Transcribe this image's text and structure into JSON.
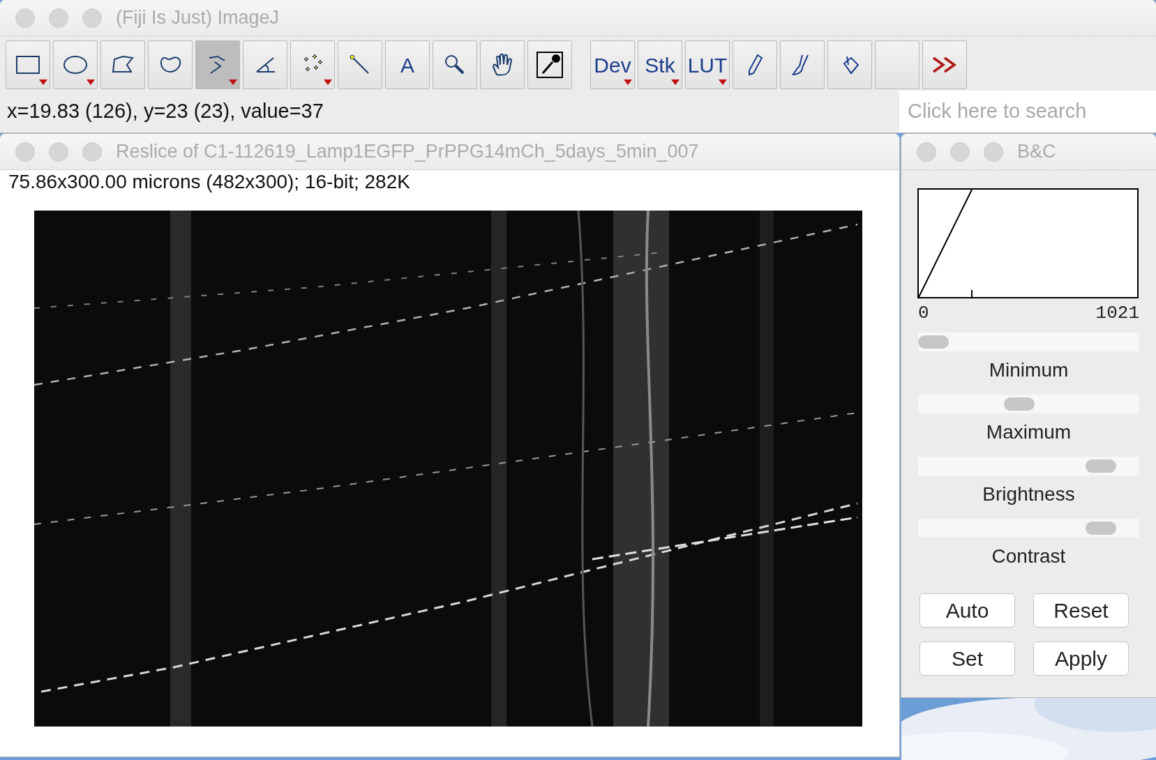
{
  "main_window": {
    "title": "(Fiji Is Just) ImageJ",
    "tools": [
      {
        "kind": "icon",
        "selected": false,
        "menu": true
      },
      {
        "kind": "icon",
        "selected": false,
        "menu": true
      },
      {
        "kind": "icon",
        "selected": false,
        "menu": false
      },
      {
        "kind": "icon",
        "selected": false,
        "menu": false
      },
      {
        "kind": "icon",
        "selected": true,
        "menu": true
      },
      {
        "kind": "icon",
        "selected": false,
        "menu": false
      },
      {
        "kind": "icon",
        "selected": false,
        "menu": true
      },
      {
        "kind": "icon",
        "selected": false,
        "menu": false
      },
      {
        "kind": "text",
        "label": "A",
        "selected": false,
        "menu": false
      },
      {
        "kind": "icon",
        "selected": false,
        "menu": false
      },
      {
        "kind": "icon",
        "selected": false,
        "menu": false
      },
      {
        "kind": "icon",
        "selected": false,
        "menu": false
      },
      {
        "kind": "text",
        "label": "Dev",
        "selected": false,
        "menu": true,
        "gap": true
      },
      {
        "kind": "text",
        "label": "Stk",
        "selected": false,
        "menu": true
      },
      {
        "kind": "text",
        "label": "LUT",
        "selected": false,
        "menu": true
      },
      {
        "kind": "icon",
        "selected": false,
        "menu": false
      },
      {
        "kind": "icon",
        "selected": false,
        "menu": false
      },
      {
        "kind": "icon",
        "selected": false,
        "menu": false
      },
      {
        "kind": "blank",
        "selected": false,
        "menu": false
      },
      {
        "kind": "more",
        "selected": false,
        "menu": false
      }
    ],
    "status": "x=19.83 (126), y=23 (23), value=37",
    "search": {
      "placeholder": "Click here to search"
    }
  },
  "image_window": {
    "title": "Reslice of C1-112619_Lamp1EGFP_PrPPG14mCh_5days_5min_007",
    "info": "75.86x300.00 microns (482x300); 16-bit; 282K"
  },
  "bc_window": {
    "title": "B&C",
    "histogram": {
      "min_label": "0",
      "max_label": "1021"
    },
    "sliders": [
      {
        "label": "Minimum",
        "level": 0.0
      },
      {
        "label": "Maximum",
        "level": 0.45
      },
      {
        "label": "Brightness",
        "level": 0.88
      },
      {
        "label": "Contrast",
        "level": 0.88
      }
    ],
    "buttons": [
      "Auto",
      "Reset",
      "Set",
      "Apply"
    ]
  }
}
